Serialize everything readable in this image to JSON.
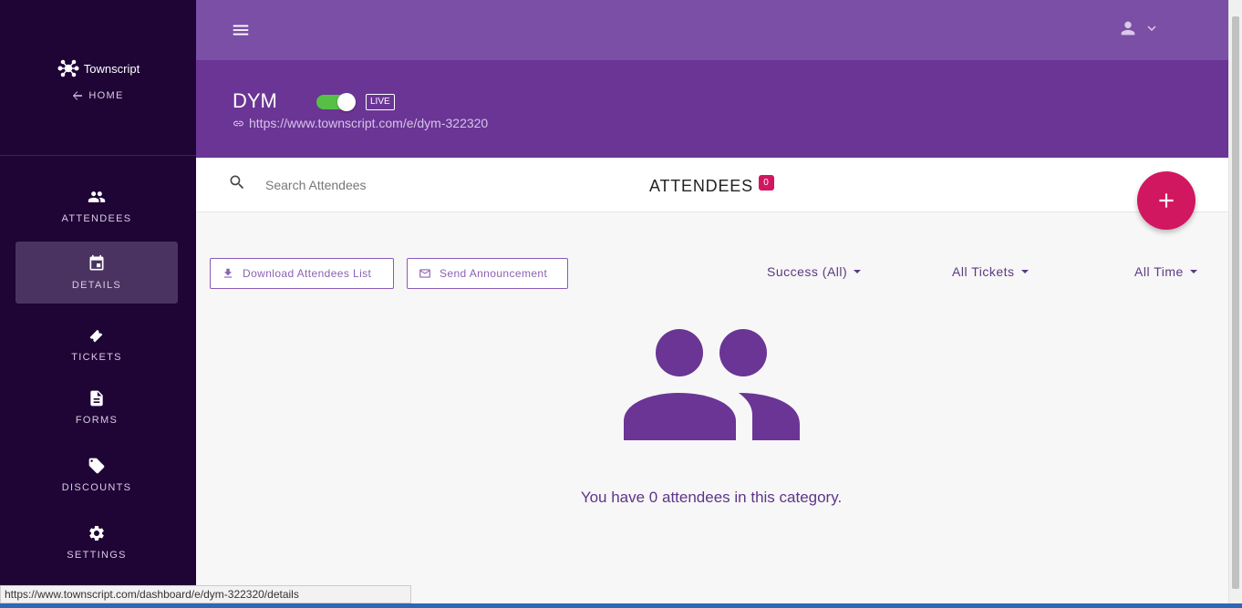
{
  "sidebar": {
    "brand": "Townscript",
    "home_label": "HOME",
    "items": [
      {
        "label": "ATTENDEES",
        "icon": "people-icon"
      },
      {
        "label": "DETAILS",
        "icon": "calendar-icon",
        "active": true
      },
      {
        "label": "TICKETS",
        "icon": "ticket-icon"
      },
      {
        "label": "FORMS",
        "icon": "document-icon"
      },
      {
        "label": "DISCOUNTS",
        "icon": "tag-icon"
      },
      {
        "label": "SETTINGS",
        "icon": "gear-icon"
      }
    ]
  },
  "topbar": {
    "menu_icon": "hamburger-icon",
    "user_icon": "user-icon"
  },
  "event": {
    "title": "DYM",
    "status": "LIVE",
    "url": "https://www.townscript.com/e/dym-322320"
  },
  "search": {
    "placeholder": "Search Attendees"
  },
  "attendees": {
    "heading": "ATTENDEES",
    "count": "0"
  },
  "actions": {
    "download_label": "Download Attendees List",
    "announce_label": "Send Announcement"
  },
  "filters": {
    "status": "Success (All)",
    "tickets": "All Tickets",
    "time": "All Time"
  },
  "empty_state": {
    "message": "You have 0 attendees in this category."
  },
  "status_bar": {
    "url": "https://www.townscript.com/dashboard/e/dym-322320/details"
  },
  "colors": {
    "sidebar": "#1f0436",
    "topbar": "#7b4fa6",
    "header": "#6a3594",
    "accent": "#d1175f",
    "toggle_on": "#56c046"
  }
}
